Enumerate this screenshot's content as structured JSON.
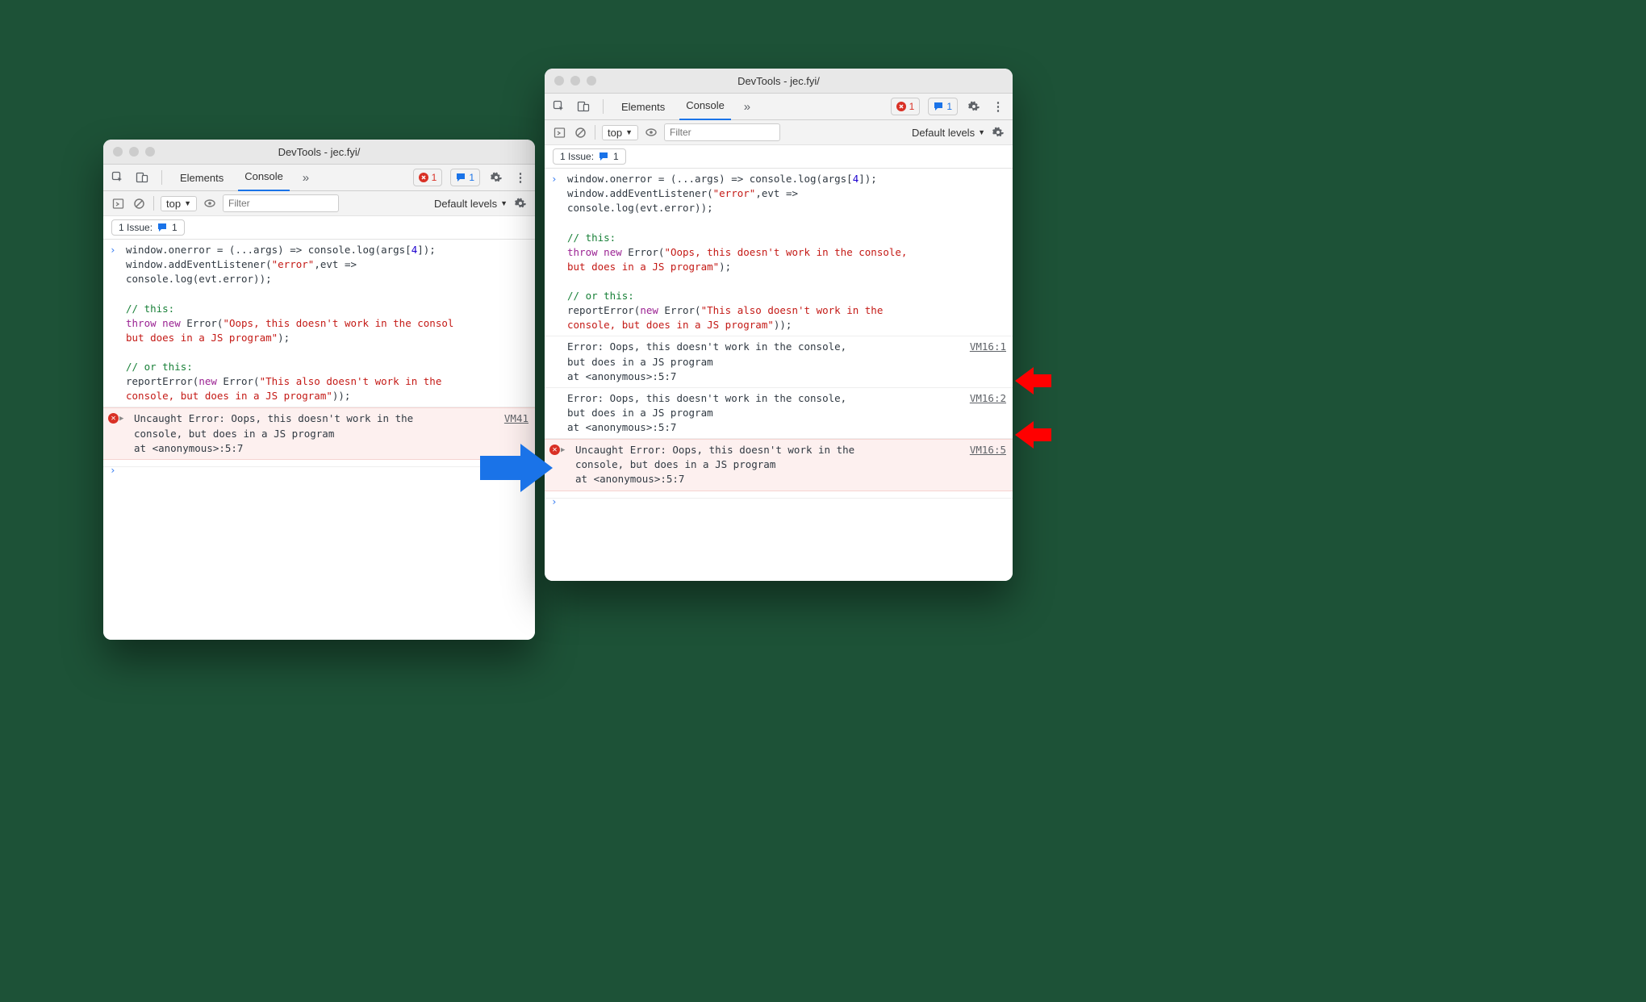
{
  "left": {
    "title": "DevTools - jec.fyi/",
    "tabs": {
      "elements": "Elements",
      "console": "Console"
    },
    "err_count": "1",
    "msg_count": "1",
    "toolbar": {
      "context": "top",
      "filter_placeholder": "Filter",
      "levels": "Default levels"
    },
    "issue": {
      "label": "1 Issue:",
      "count": "1"
    },
    "code": {
      "l1a": "window.onerror = (...args) => console.log(args[",
      "l1b": "4",
      "l1c": "]);",
      "l2a": "window.addEventListener(",
      "l2b": "\"error\"",
      "l2c": ",evt =>",
      "l3": "console.log(evt.error));",
      "c1": "// this:",
      "t1a": "throw",
      "t1b": "new",
      "t1c": "Error(",
      "t1d": "\"Oops, this doesn't work in the consol",
      "t1e": "but does in a JS program\"",
      "t1f": ");",
      "c2": "// or this:",
      "r1a": "reportError(",
      "r1b": "new",
      "r1c": "Error(",
      "r1d": "\"This also doesn't work in the",
      "r1e": "console, but does in a JS program\"",
      "r1f": "));"
    },
    "error": {
      "l1": "Uncaught Error: Oops, this doesn't work in the",
      "l2": "console, but does in a JS program",
      "l3": "    at <anonymous>:5:7",
      "loc": "VM41"
    }
  },
  "right": {
    "title": "DevTools - jec.fyi/",
    "tabs": {
      "elements": "Elements",
      "console": "Console"
    },
    "err_count": "1",
    "msg_count": "1",
    "toolbar": {
      "context": "top",
      "filter_placeholder": "Filter",
      "levels": "Default levels"
    },
    "issue": {
      "label": "1 Issue:",
      "count": "1"
    },
    "code": {
      "l1a": "window.onerror = (...args) => console.log(args[",
      "l1b": "4",
      "l1c": "]);",
      "l2a": "window.addEventListener(",
      "l2b": "\"error\"",
      "l2c": ",evt =>",
      "l3": "console.log(evt.error));",
      "c1": "// this:",
      "t1a": "throw",
      "t1b": "new",
      "t1c": "Error(",
      "t1d": "\"Oops, this doesn't work in the console,",
      "t1e": "but does in a JS program\"",
      "t1f": ");",
      "c2": "// or this:",
      "r1a": "reportError(",
      "r1b": "new",
      "r1c": "Error(",
      "r1d": "\"This also doesn't work in the",
      "r1e": "console, but does in a JS program\"",
      "r1f": "));"
    },
    "log1": {
      "l1": "Error: Oops, this doesn't work in the console,",
      "l2": "but does in a JS program",
      "l3": "    at <anonymous>:5:7",
      "loc": "VM16:1"
    },
    "log2": {
      "l1": "Error: Oops, this doesn't work in the console,",
      "l2": "but does in a JS program",
      "l3": "    at <anonymous>:5:7",
      "loc": "VM16:2"
    },
    "error": {
      "l1": "Uncaught Error: Oops, this doesn't work in the",
      "l2": "console, but does in a JS program",
      "l3": "    at <anonymous>:5:7",
      "loc": "VM16:5"
    }
  }
}
